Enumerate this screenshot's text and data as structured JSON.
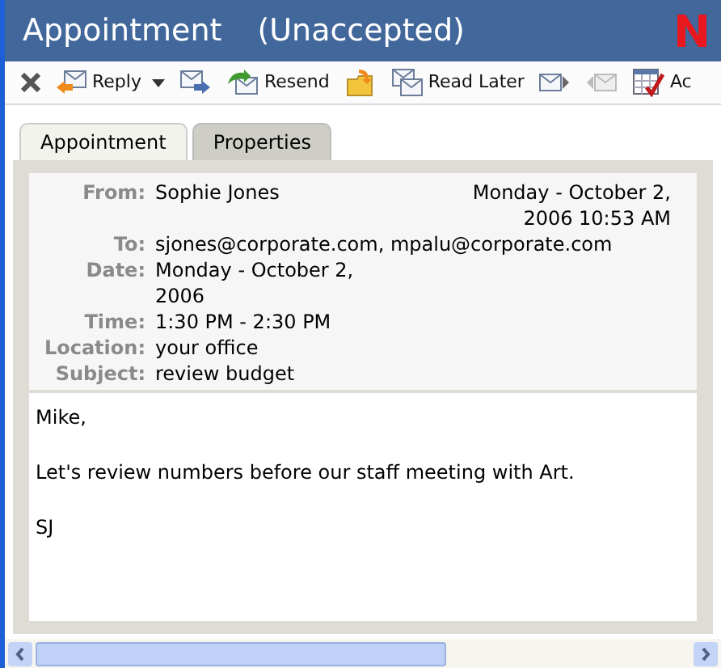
{
  "window": {
    "title": "Appointment",
    "status": "(Unaccepted)"
  },
  "toolbar": [
    {
      "kind": "delete"
    },
    {
      "kind": "reply",
      "label": "Reply",
      "menu": true
    },
    {
      "kind": "forward"
    },
    {
      "kind": "resend",
      "label": "Resend"
    },
    {
      "kind": "move"
    },
    {
      "kind": "read-later",
      "label": "Read Later"
    },
    {
      "kind": "next"
    },
    {
      "kind": "previous",
      "disabled": true
    },
    {
      "kind": "calendar",
      "label": "Ac"
    }
  ],
  "tabs": [
    {
      "label": "Appointment",
      "selected": true
    },
    {
      "label": "Properties",
      "selected": false
    }
  ],
  "header": {
    "sent": "Monday - October 2, 2006 10:53 AM",
    "fields": [
      {
        "label": "From:",
        "value": "Sophie Jones"
      },
      {
        "label": "To:",
        "value": "sjones@corporate.com, mpalu@corporate.com"
      },
      {
        "label": "Date:",
        "value": "Monday - October 2, 2006"
      },
      {
        "label": "Time:",
        "value": "1:30 PM - 2:30 PM"
      },
      {
        "label": "Location:",
        "value": "your office"
      },
      {
        "label": "Subject:",
        "value": "review budget"
      }
    ]
  },
  "body": [
    "Mike,",
    "Let's review numbers before our staff meeting with Art.",
    "SJ"
  ]
}
